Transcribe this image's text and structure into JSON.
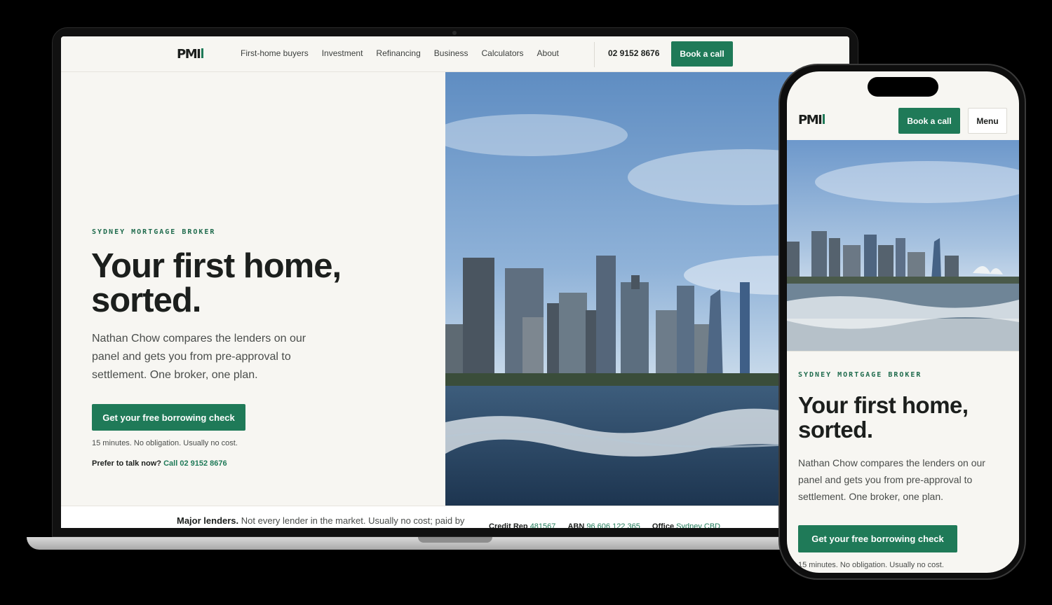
{
  "brand": {
    "logo": "PMI",
    "accent": "#1f7a58",
    "background": "#f7f6f2"
  },
  "desktop": {
    "nav": [
      "First-home buyers",
      "Investment",
      "Refinancing",
      "Business",
      "Calculators",
      "About"
    ],
    "phone": "02 9152 8676",
    "book_label": "Book a call",
    "kicker": "SYDNEY MORTGAGE BROKER",
    "title_line1": "Your first home,",
    "title_line2": "sorted.",
    "body": "Nathan Chow compares the lenders on our panel and gets you from pre-approval to settlement. One broker, one plan.",
    "cta": "Get your free borrowing check",
    "note": "15 minutes. No obligation. Usually no cost.",
    "talk_prefix": "Prefer to talk now?",
    "talk_link": "Call 02 9152 8676",
    "strip": {
      "lenders_bold": "Major lenders.",
      "lenders_text": "Not every lender in the market. Usually no cost; paid by",
      "credit_label": "Credit Rep",
      "credit_value": "481567",
      "abn_label": "ABN",
      "abn_value": "96 606 122 365",
      "office_label": "Office",
      "office_value": "Sydney CBD"
    },
    "photo_icon": "sydney-skyline-image"
  },
  "mobile": {
    "book_label": "Book a call",
    "menu_label": "Menu",
    "kicker": "SYDNEY MORTGAGE BROKER",
    "title_line1": "Your first home,",
    "title_line2": "sorted.",
    "body": "Nathan Chow compares the lenders on our panel and gets you from pre-approval to settlement. One broker, one plan.",
    "cta": "Get your free borrowing check",
    "note": "15 minutes. No obligation. Usually no cost."
  }
}
